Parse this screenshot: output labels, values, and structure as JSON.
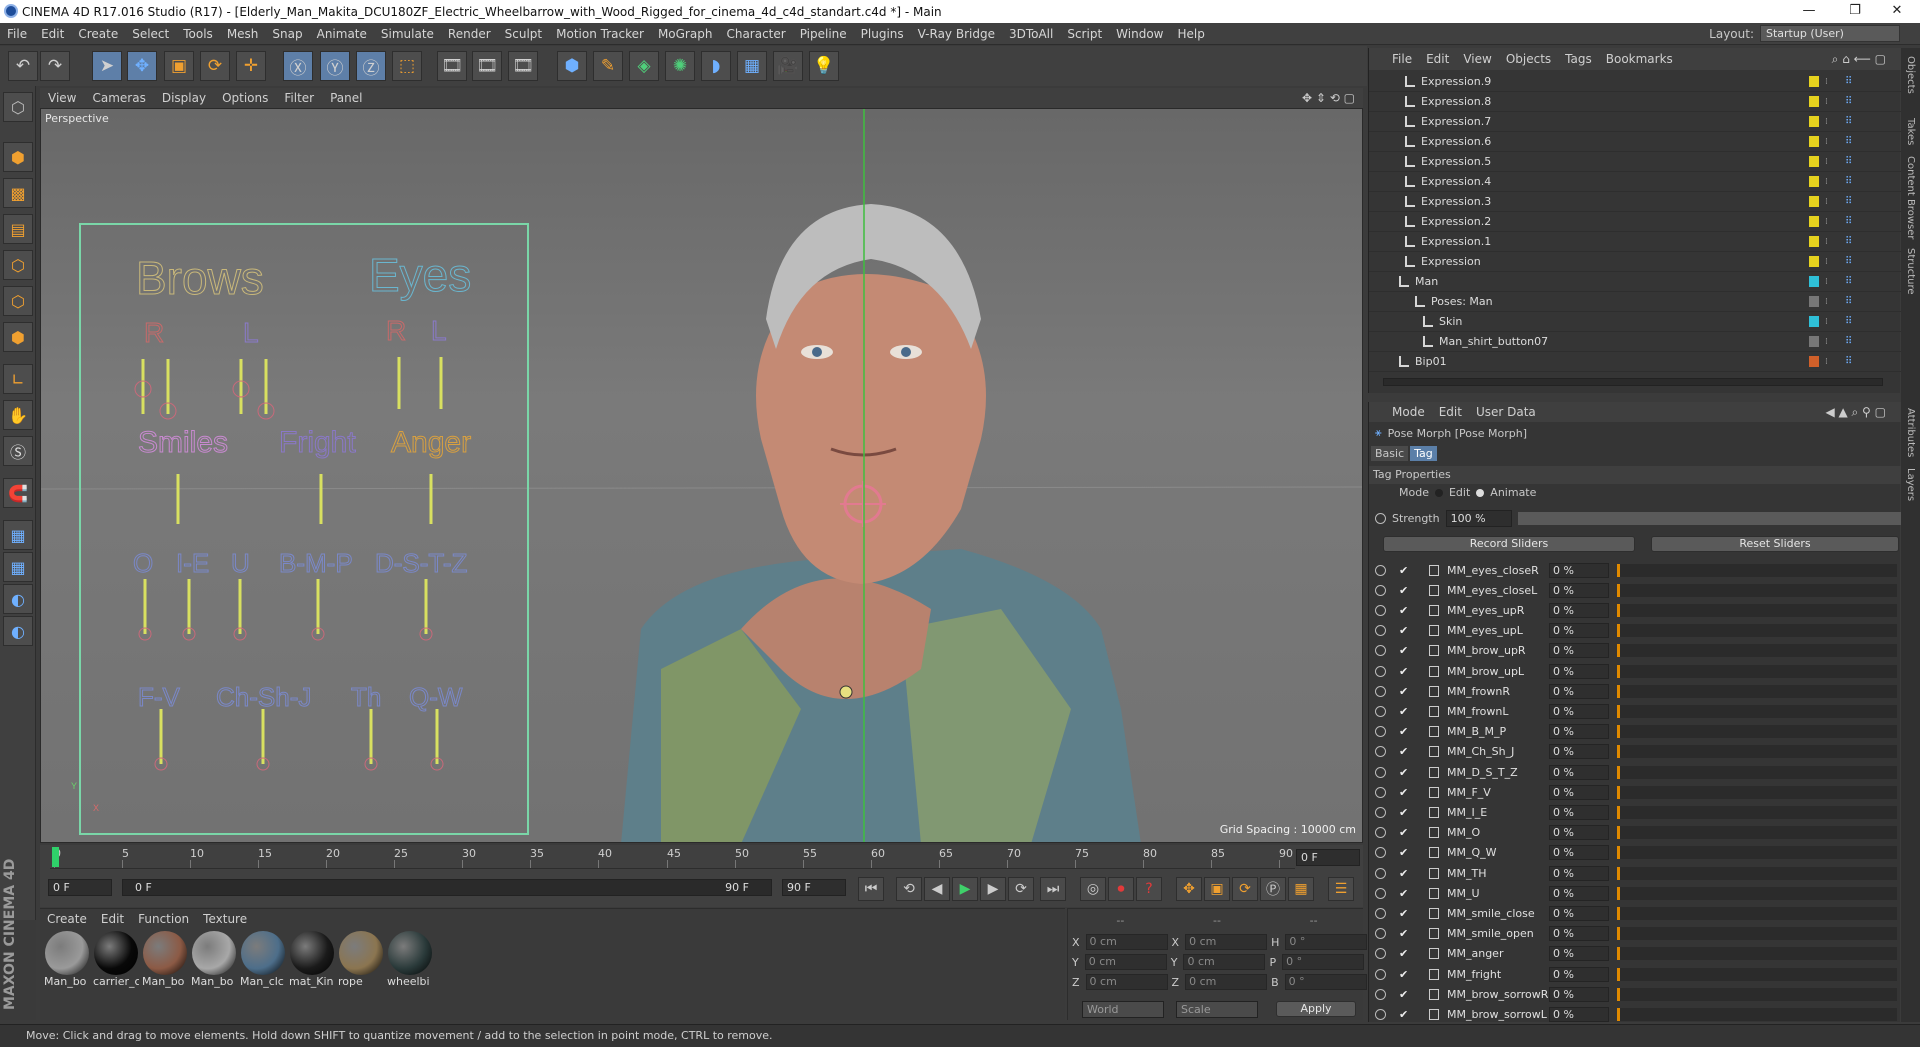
{
  "title": "CINEMA 4D R17.016 Studio (R17) - [Elderly_Man_Makita_DCU180ZF_Electric_Wheelbarrow_with_Wood_Rigged_for_cinema_4d_c4d_standart.c4d *] - Main",
  "menu": [
    "File",
    "Edit",
    "Create",
    "Select",
    "Tools",
    "Mesh",
    "Snap",
    "Animate",
    "Simulate",
    "Render",
    "Sculpt",
    "Motion Tracker",
    "MoGraph",
    "Character",
    "Pipeline",
    "Plugins",
    "V-Ray Bridge",
    "3DToAll",
    "Script",
    "Window",
    "Help"
  ],
  "layout_label": "Layout:",
  "layout_value": "Startup (User)",
  "viewport_menu": [
    "View",
    "Cameras",
    "Display",
    "Options",
    "Filter",
    "Panel"
  ],
  "viewport_label": "Perspective",
  "grid_spacing": "Grid Spacing : 10000 cm",
  "rig_labels": {
    "brows": "Brows",
    "eyes": "Eyes",
    "r1": "R",
    "l1": "L",
    "r2": "R",
    "l2": "L",
    "smiles": "Smiles",
    "fright": "Fright",
    "anger": "Anger",
    "o": "O",
    "ie": "I-E",
    "u": "U",
    "bmp": "B-M-P",
    "dstz": "D-S-T-Z",
    "fv": "F-V",
    "chshj": "Ch-Sh-J",
    "th": "Th",
    "qw": "Q-W",
    "axis_y": "Y",
    "axis_x": "X"
  },
  "timeline": {
    "ticks": [
      "0",
      "5",
      "10",
      "15",
      "20",
      "25",
      "30",
      "35",
      "40",
      "45",
      "50",
      "55",
      "60",
      "65",
      "70",
      "75",
      "80",
      "85",
      "90"
    ],
    "current_frame": "0 F",
    "start": "0 F",
    "range_start": "0 F",
    "range_end": "90 F",
    "end": "90 F",
    "end_field": "0 F"
  },
  "material_menu": [
    "Create",
    "Edit",
    "Function",
    "Texture"
  ],
  "materials": [
    {
      "name": "Man_bo",
      "color": "#9a9a9a"
    },
    {
      "name": "carrier_c",
      "color": "#080808"
    },
    {
      "name": "Man_bo",
      "color": "#8c5a45"
    },
    {
      "name": "Man_bo",
      "color": "#a8a8a8"
    },
    {
      "name": "Man_clc",
      "color": "#4d6e8a"
    },
    {
      "name": "mat_Kin",
      "color": "#1a1a1a"
    },
    {
      "name": "rope",
      "color": "#8b7550"
    },
    {
      "name": "wheelbi",
      "color": "#2a3a3a"
    }
  ],
  "coords": {
    "header": [
      "--",
      "--",
      "--"
    ],
    "rows": [
      {
        "a": "X",
        "av": "0 cm",
        "b": "X",
        "bv": "0 cm",
        "c": "H",
        "cv": "0 °"
      },
      {
        "a": "Y",
        "av": "0 cm",
        "b": "Y",
        "bv": "0 cm",
        "c": "P",
        "cv": "0 °"
      },
      {
        "a": "Z",
        "av": "0 cm",
        "b": "Z",
        "bv": "0 cm",
        "c": "B",
        "cv": "0 °"
      }
    ],
    "world": "World",
    "scale": "Scale",
    "apply": "Apply"
  },
  "status": "Move: Click and drag to move elements. Hold down SHIFT to quantize movement / add to the selection in point mode, CTRL to remove.",
  "maxon": "MAXON CINEMA 4D",
  "object_menu": [
    "File",
    "Edit",
    "View",
    "Objects",
    "Tags",
    "Bookmarks"
  ],
  "objects": [
    {
      "name": "Expression.9",
      "indent": 36,
      "color": "#e6d21e"
    },
    {
      "name": "Expression.8",
      "indent": 36,
      "color": "#e6d21e"
    },
    {
      "name": "Expression.7",
      "indent": 36,
      "color": "#e6d21e"
    },
    {
      "name": "Expression.6",
      "indent": 36,
      "color": "#e6d21e"
    },
    {
      "name": "Expression.5",
      "indent": 36,
      "color": "#e6d21e"
    },
    {
      "name": "Expression.4",
      "indent": 36,
      "color": "#e6d21e"
    },
    {
      "name": "Expression.3",
      "indent": 36,
      "color": "#e6d21e"
    },
    {
      "name": "Expression.2",
      "indent": 36,
      "color": "#e6d21e"
    },
    {
      "name": "Expression.1",
      "indent": 36,
      "color": "#e6d21e"
    },
    {
      "name": "Expression",
      "indent": 36,
      "color": "#e6d21e"
    },
    {
      "name": "Man",
      "indent": 30,
      "color": "#2fc0d8"
    },
    {
      "name": "Poses: Man",
      "indent": 46,
      "color": "#777777"
    },
    {
      "name": "Skin",
      "indent": 54,
      "color": "#2fc0d8"
    },
    {
      "name": "Man_shirt_button07",
      "indent": 54,
      "color": "#777777"
    },
    {
      "name": "Bip01",
      "indent": 30,
      "color": "#d0602a"
    }
  ],
  "attr_menu": [
    "Mode",
    "Edit",
    "User Data"
  ],
  "attr": {
    "tag_name": "Pose Morph [Pose Morph]",
    "tabs": [
      "Basic",
      "Tag"
    ],
    "section": "Tag Properties",
    "mode_label": "Mode",
    "mode_edit": "Edit",
    "mode_animate": "Animate",
    "strength_label": "Strength",
    "strength_value": "100 %",
    "record": "Record Sliders",
    "reset": "Reset Sliders"
  },
  "sliders": [
    {
      "name": "MM_eyes_closeR",
      "value": "0 %"
    },
    {
      "name": "MM_eyes_closeL",
      "value": "0 %"
    },
    {
      "name": "MM_eyes_upR",
      "value": "0 %"
    },
    {
      "name": "MM_eyes_upL",
      "value": "0 %"
    },
    {
      "name": "MM_brow_upR",
      "value": "0 %"
    },
    {
      "name": "MM_brow_upL",
      "value": "0 %"
    },
    {
      "name": "MM_frownR",
      "value": "0 %"
    },
    {
      "name": "MM_frownL",
      "value": "0 %"
    },
    {
      "name": "MM_B_M_P",
      "value": "0 %"
    },
    {
      "name": "MM_Ch_Sh_J",
      "value": "0 %"
    },
    {
      "name": "MM_D_S_T_Z",
      "value": "0 %"
    },
    {
      "name": "MM_F_V",
      "value": "0 %"
    },
    {
      "name": "MM_I_E",
      "value": "0 %"
    },
    {
      "name": "MM_O",
      "value": "0 %"
    },
    {
      "name": "MM_Q_W",
      "value": "0 %"
    },
    {
      "name": "MM_TH",
      "value": "0 %"
    },
    {
      "name": "MM_U",
      "value": "0 %"
    },
    {
      "name": "MM_smile_close",
      "value": "0 %"
    },
    {
      "name": "MM_smile_open",
      "value": "0 %"
    },
    {
      "name": "MM_anger",
      "value": "0 %"
    },
    {
      "name": "MM_fright",
      "value": "0 %"
    },
    {
      "name": "MM_brow_sorrowR",
      "value": "0 %"
    },
    {
      "name": "MM_brow_sorrowL",
      "value": "0 %"
    }
  ],
  "side_tabs": [
    "Objects",
    "Takes",
    "Content Browser",
    "Structure"
  ],
  "side_tabs2": [
    "Attributes",
    "Layers"
  ]
}
